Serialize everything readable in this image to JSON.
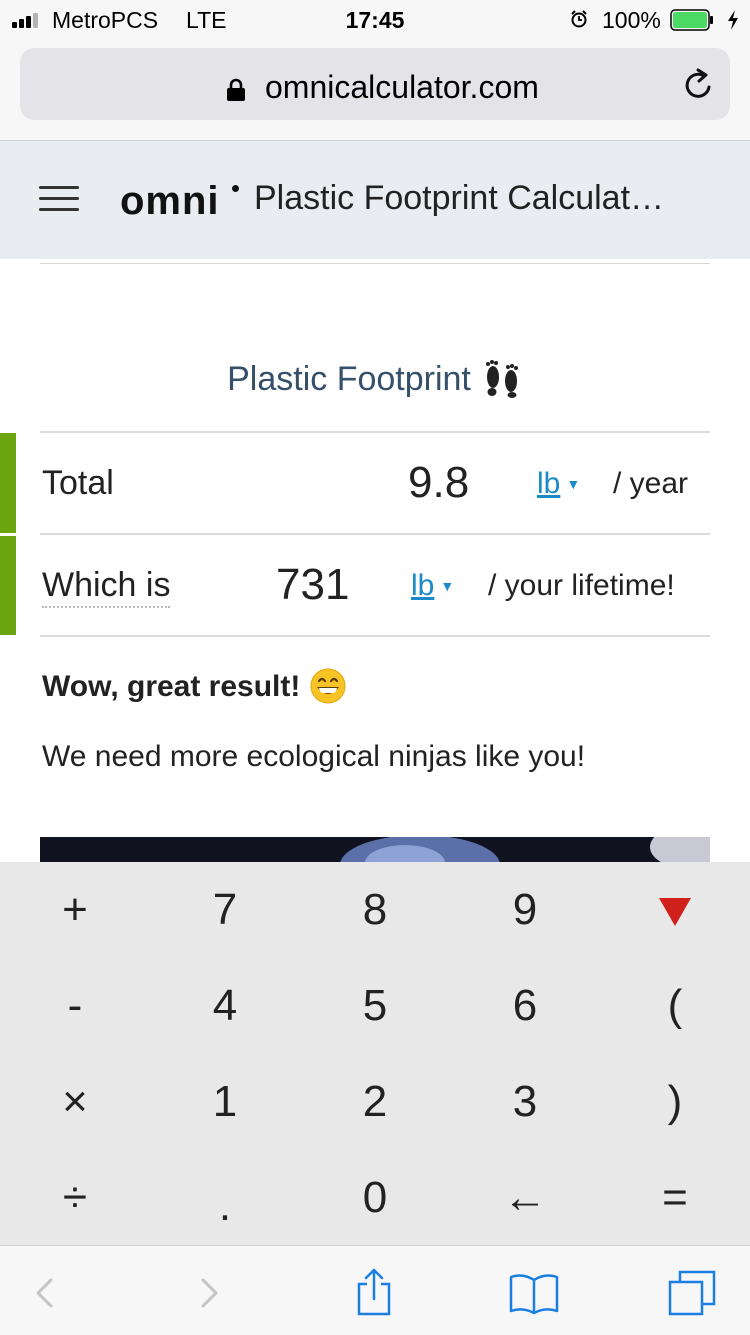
{
  "status_bar": {
    "carrier": "MetroPCS",
    "network": "LTE",
    "time": "17:45",
    "battery_percent": "100%",
    "battery_level": 1.0,
    "battery_color": "#4cd964"
  },
  "browser": {
    "url": "omnicalculator.com"
  },
  "site": {
    "logo": "omni",
    "page_title": "Plastic Footprint Calculat…"
  },
  "calculator": {
    "section_title": "Plastic Footprint",
    "rows": [
      {
        "label": "Total",
        "value": "9.8",
        "unit": "lb",
        "suffix": "/ year"
      },
      {
        "label": "Which is",
        "value": "731",
        "unit": "lb",
        "suffix": "/ your lifetime!"
      }
    ],
    "result_heading": "Wow, great result!",
    "result_message": "We need more ecological ninjas like you!"
  },
  "keypad": {
    "keys": [
      [
        "+",
        "7",
        "8",
        "9",
        "collapse-arrow-icon"
      ],
      [
        "-",
        "4",
        "5",
        "6",
        "("
      ],
      [
        "×",
        "1",
        "2",
        "3",
        ")"
      ],
      [
        "÷",
        ".",
        "0",
        "←",
        "="
      ]
    ],
    "collapse_color": "#d0201b"
  },
  "colors": {
    "accent_green": "#6aa40f",
    "link_blue": "#1a8bc8",
    "title_blue": "#35506b",
    "toolbar_blue": "#1a7fe0"
  }
}
